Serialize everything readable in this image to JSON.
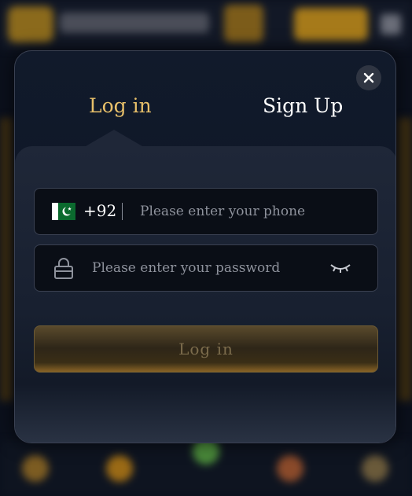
{
  "modal": {
    "tabs": [
      {
        "label": "Log in",
        "active": true
      },
      {
        "label": "Sign Up",
        "active": false
      }
    ],
    "close_icon": "close-icon"
  },
  "form": {
    "phone": {
      "flag_icon": "pakistan-flag-icon",
      "country_code": "+92",
      "value": "",
      "placeholder": "Please enter your phone"
    },
    "password": {
      "lock_icon": "lock-icon",
      "value": "",
      "placeholder": "Please enter your password",
      "toggle_icon": "eye-closed-icon"
    },
    "submit_label": "Log in"
  },
  "colors": {
    "accent_gold": "#e8c06a",
    "modal_bg": "#111a2b",
    "input_bg": "#0a0e16"
  }
}
